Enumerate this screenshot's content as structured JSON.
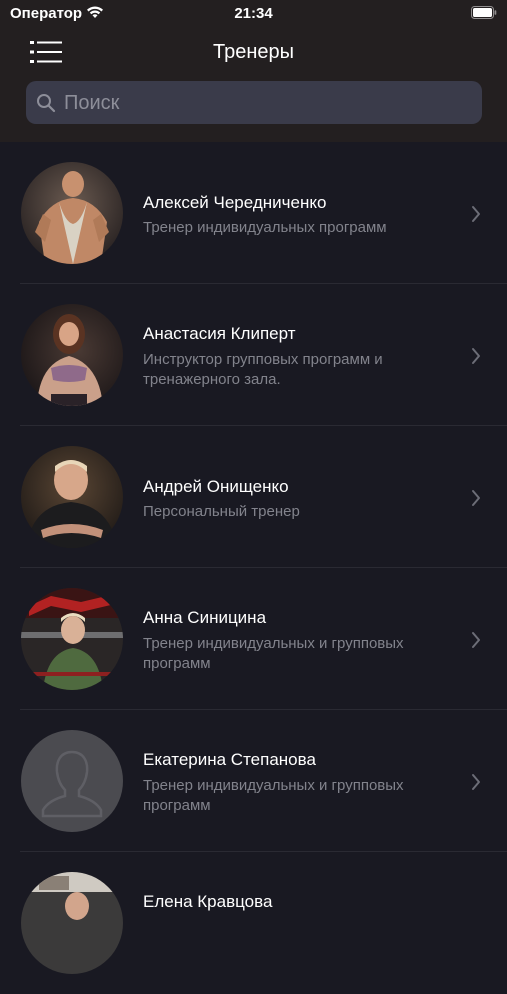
{
  "status_bar": {
    "carrier": "Оператор",
    "time": "21:34"
  },
  "header": {
    "title": "Тренеры"
  },
  "search": {
    "placeholder": "Поиск"
  },
  "trainers": [
    {
      "name": "Алексей Чередниченко",
      "role": "Тренер индивидуальных программ",
      "avatar": "photo"
    },
    {
      "name": "Анастасия Клиперт",
      "role": "Инструктор групповых программ и тренажерного зала.",
      "avatar": "photo"
    },
    {
      "name": "Андрей Онищенко",
      "role": "Персональный тренер",
      "avatar": "photo"
    },
    {
      "name": "Анна Синицина",
      "role": "Тренер индивидуальных и групповых программ",
      "avatar": "photo"
    },
    {
      "name": "Екатерина Степанова",
      "role": "Тренер индивидуальных и групповых программ",
      "avatar": "placeholder-silhouette"
    },
    {
      "name": "Елена Кравцова",
      "role": "",
      "avatar": "photo"
    }
  ],
  "colors": {
    "background": "#191922",
    "header": "#231f20",
    "search_field": "#3a3b4a",
    "secondary_text": "#82838c"
  }
}
